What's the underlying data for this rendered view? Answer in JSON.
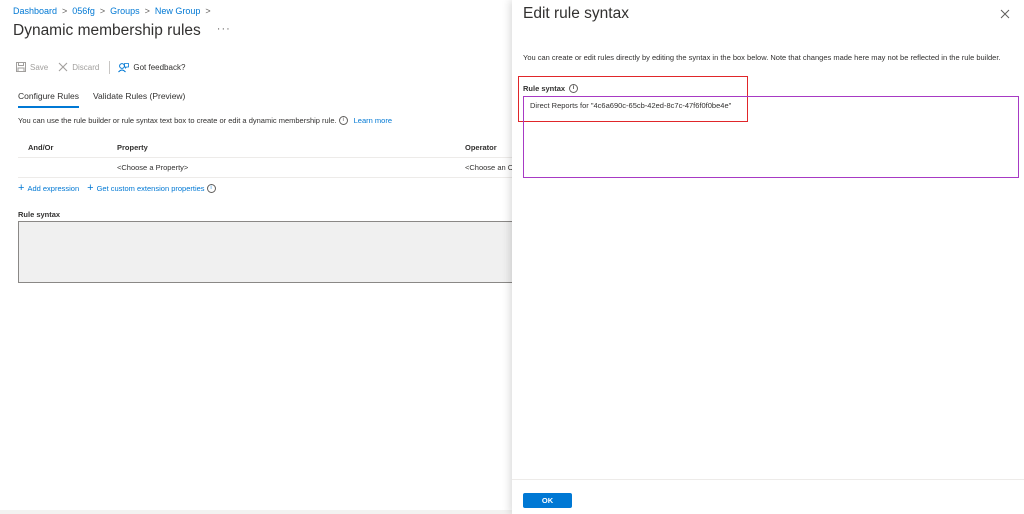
{
  "breadcrumb": {
    "items": [
      "Dashboard",
      "056fg",
      "Groups",
      "New Group"
    ],
    "separator": ">"
  },
  "page": {
    "title": "Dynamic membership rules",
    "more": "···"
  },
  "toolbar": {
    "save": "Save",
    "discard": "Discard",
    "feedback": "Got feedback?"
  },
  "tabs": [
    "Configure Rules",
    "Validate Rules (Preview)"
  ],
  "intro": {
    "text": "You can use the rule builder or rule syntax text box to create or edit a dynamic membership rule.",
    "info": "i",
    "learn_more": "Learn more"
  },
  "rule_table": {
    "headers": [
      "And/Or",
      "Property",
      "Operator"
    ],
    "row": [
      "",
      "<Choose a Property>",
      "<Choose an Operator>"
    ]
  },
  "links": {
    "add_expression": "Add expression",
    "custom_ext": "Get custom extension properties"
  },
  "rule_syntax_left": {
    "label": "Rule syntax",
    "value": ""
  },
  "panel": {
    "title": "Edit rule syntax",
    "description": "You can create or edit rules directly by editing the syntax in the box below. Note that changes made here may not be reflected in the rule builder.",
    "rule_syntax_label": "Rule syntax",
    "rule_syntax_value": "Direct Reports for \"4c6a690c-65cb-42ed-8c7c-47f6f0f0be4e\"",
    "ok": "OK"
  },
  "colors": {
    "accent": "#0078d4",
    "highlight_red": "#e0262a",
    "highlight_purple": "#a73ac4"
  }
}
